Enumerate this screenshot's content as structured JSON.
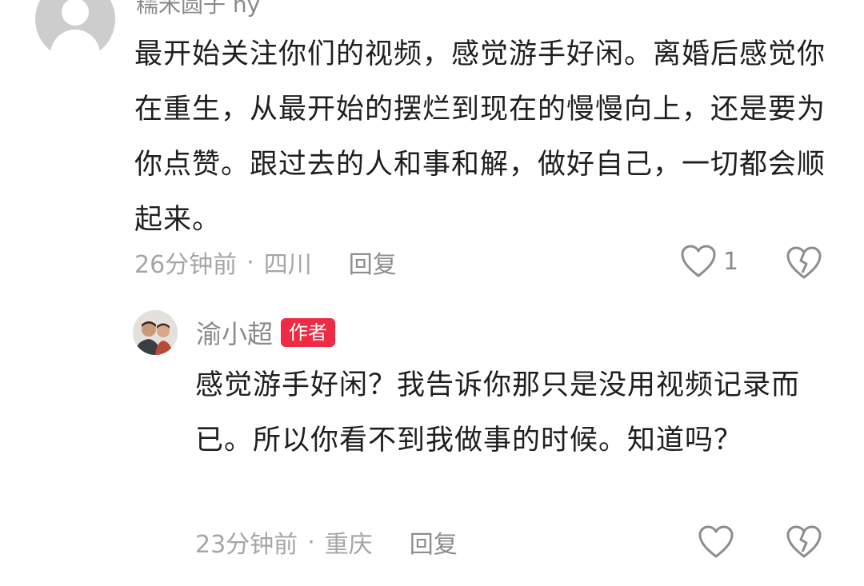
{
  "comment": {
    "username": "糯米圆子 ny",
    "text": "最开始关注你们的视频，感觉游手好闲。离婚后感觉你在重生，从最开始的摆烂到现在的慢慢向上，还是要为你点赞。跟过去的人和事和解，做好自己，一切都会顺起来。",
    "time": "26分钟前",
    "separator": "·",
    "location": "四川",
    "reply_label": "回复",
    "like_count": "1"
  },
  "reply": {
    "username": "渝小超",
    "badge": "作者",
    "text": "感觉游手好闲？我告诉你那只是没用视频记录而已。所以你看不到我做事的时候。知道吗？",
    "time": "23分钟前",
    "separator": "·",
    "location": "重庆",
    "reply_label": "回复"
  },
  "icons": {
    "like": "heart-outline-icon",
    "dislike": "broken-heart-icon"
  },
  "colors": {
    "badge_bg": "#ee2b44",
    "meta_text": "#a6a6a6",
    "body_text": "#1f1f1f"
  }
}
